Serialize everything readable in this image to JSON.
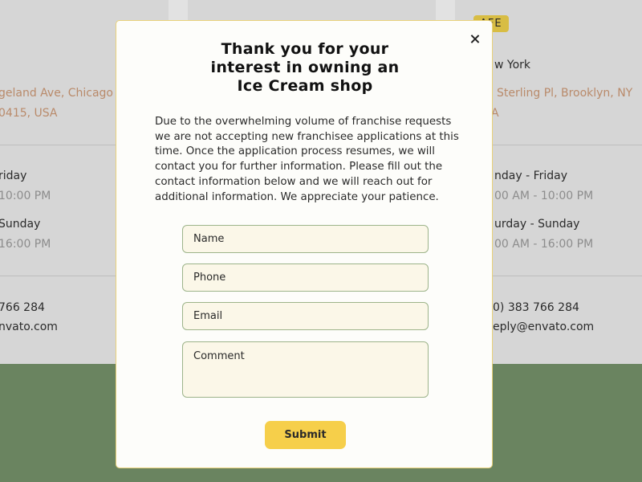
{
  "background": {
    "left_column": {
      "address_line1": "geland Ave, Chicago",
      "address_line2": "0415, USA",
      "hours": [
        {
          "days": "riday",
          "time": "10:00 PM"
        },
        {
          "days": "Sunday",
          "time": "16:00 PM"
        }
      ],
      "phone": "766 284",
      "email": "nvato.com"
    },
    "right_column": {
      "badge": "AFE",
      "city": "w York",
      "address_line1": "Sterling Pl, Brooklyn, NY",
      "address_line2": "A",
      "hours": [
        {
          "days": "nday - Friday",
          "time": "00 AM - 10:00 PM"
        },
        {
          "days": "urday - Sunday",
          "time": "00 AM - 16:00 PM"
        }
      ],
      "phone": "0) 383 766 284",
      "email": "eply@envato.com"
    }
  },
  "modal": {
    "title_line1": "Thank you for your",
    "title_line2": "interest in owning an",
    "title_line3": "Ice Cream shop",
    "body": "Due to the overwhelming volume of franchise requests we are not accepting new franchisee applications at this time. Once the application process resumes, we will contact you for further information. Please fill out the contact information below and we will reach out for additional information. We appreciate your patience.",
    "fields": {
      "name_placeholder": "Name",
      "phone_placeholder": "Phone",
      "email_placeholder": "Email",
      "comment_placeholder": "Comment"
    },
    "submit_label": "Submit",
    "close_icon": "close-icon"
  },
  "colors": {
    "accent_yellow": "#f6cf4a",
    "field_border": "#9db48a",
    "green_band": "#6a8460",
    "address_orange": "#b98a6a"
  }
}
